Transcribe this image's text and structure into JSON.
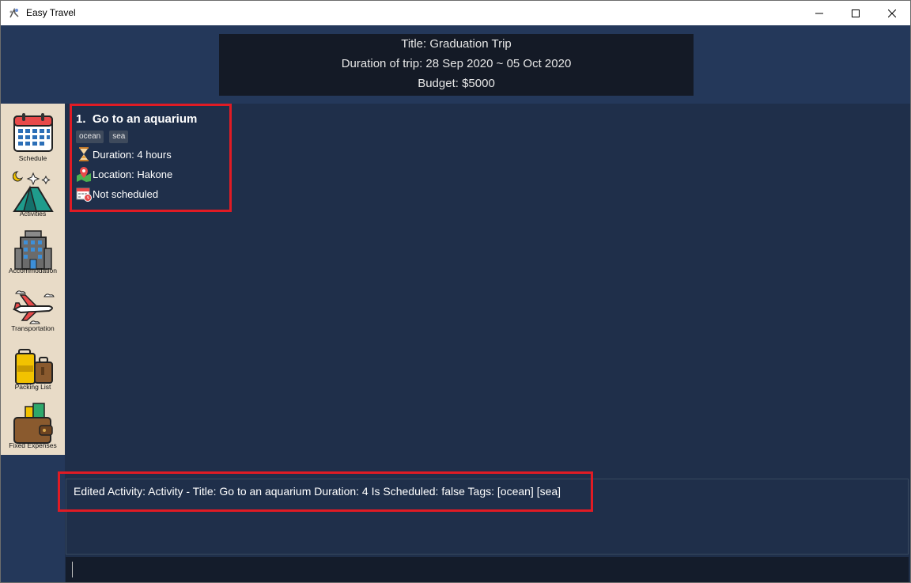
{
  "window": {
    "title": "Easy Travel",
    "controls": [
      "minimize-icon",
      "maximize-icon",
      "close-icon"
    ]
  },
  "trip": {
    "title": "Title: Graduation Trip",
    "duration": "Duration of trip: 28 Sep 2020 ~ 05 Oct 2020",
    "budget": "Budget: $5000"
  },
  "sidebar": {
    "items": [
      {
        "label": "Schedule",
        "icon": "calendar-icon"
      },
      {
        "label": "Activities",
        "icon": "tent-icon"
      },
      {
        "label": "Accommodation",
        "icon": "hotel-icon"
      },
      {
        "label": "Transportation",
        "icon": "airplane-icon"
      },
      {
        "label": "Packing List",
        "icon": "luggage-icon"
      },
      {
        "label": "Fixed Expenses",
        "icon": "wallet-icon"
      }
    ]
  },
  "activity": {
    "index_title": "1.  Go to an aquarium",
    "tags": [
      "ocean",
      "sea"
    ],
    "duration": "Duration: 4 hours",
    "location": "Location: Hakone",
    "schedule": "Not scheduled"
  },
  "result": {
    "text": "Edited Activity: Activity - Title: Go to an aquarium Duration: 4 Is Scheduled: false Tags: [ocean] [sea]"
  },
  "command": {
    "value": ""
  },
  "colors": {
    "highlight": "#e01b24",
    "background": "#1f2f4a",
    "sidebar": "#e8dbc7"
  }
}
